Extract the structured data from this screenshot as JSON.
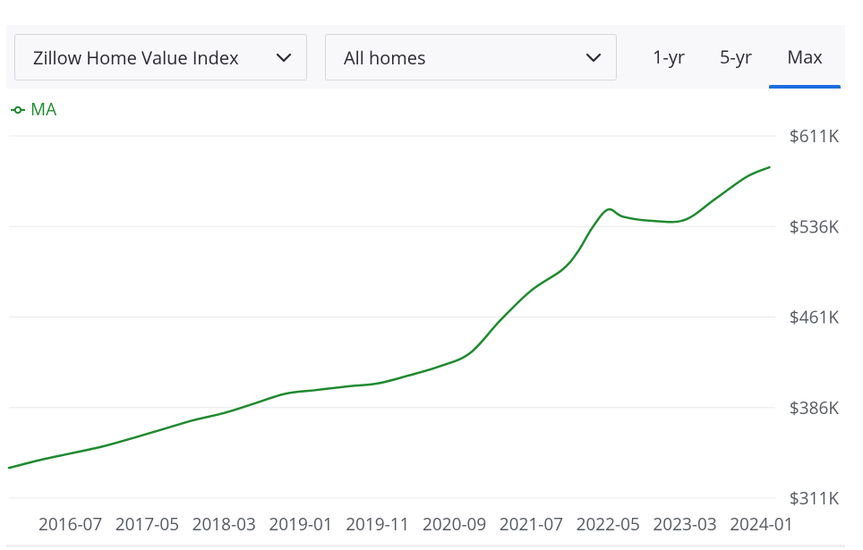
{
  "controls": {
    "metric_dropdown": "Zillow Home Value Index",
    "home_type_dropdown": "All homes",
    "range_tabs": [
      "1-yr",
      "5-yr",
      "Max"
    ],
    "active_range": "Max"
  },
  "colors": {
    "series": "#1f8a2f",
    "active_tab": "#1a6ee0",
    "grid": "#e8e8e8"
  },
  "icons": {
    "dropdown": "chevron-down-icon",
    "legend_marker": "line-circle-marker-icon"
  },
  "chart_data": {
    "type": "line",
    "title": "",
    "xlabel": "",
    "ylabel": "",
    "legend": {
      "position": "top-left"
    },
    "grid": true,
    "y_axis_side": "right",
    "ylim": [
      311000,
      611000
    ],
    "yticks": [
      311000,
      386000,
      461000,
      536000,
      611000
    ],
    "ytick_labels": [
      "$311K",
      "$386K",
      "$461K",
      "$536K",
      "$611K"
    ],
    "xlim": [
      "2015-11",
      "2024-03"
    ],
    "xticks": [
      "2016-07",
      "2017-05",
      "2018-03",
      "2019-01",
      "2019-11",
      "2020-09",
      "2021-07",
      "2022-05",
      "2023-03",
      "2024-01"
    ],
    "series": [
      {
        "name": "MA",
        "points": [
          [
            "2015-11",
            336000
          ],
          [
            "2016-03",
            342500
          ],
          [
            "2016-07",
            348000
          ],
          [
            "2016-11",
            353500
          ],
          [
            "2017-03",
            360500
          ],
          [
            "2017-07",
            368000
          ],
          [
            "2017-11",
            375500
          ],
          [
            "2018-03",
            381500
          ],
          [
            "2018-07",
            389500
          ],
          [
            "2018-11",
            397500
          ],
          [
            "2019-03",
            400500
          ],
          [
            "2019-07",
            403500
          ],
          [
            "2019-11",
            406000
          ],
          [
            "2020-03",
            412500
          ],
          [
            "2020-07",
            420000
          ],
          [
            "2020-11",
            431000
          ],
          [
            "2021-03",
            458500
          ],
          [
            "2021-07",
            483000
          ],
          [
            "2021-11",
            500000
          ],
          [
            "2022-01",
            514500
          ],
          [
            "2022-03",
            535500
          ],
          [
            "2022-05",
            550000
          ],
          [
            "2022-07",
            544000
          ],
          [
            "2022-11",
            540500
          ],
          [
            "2023-03",
            541500
          ],
          [
            "2023-07",
            559000
          ],
          [
            "2023-11",
            577000
          ],
          [
            "2024-02",
            585000
          ]
        ]
      }
    ]
  }
}
